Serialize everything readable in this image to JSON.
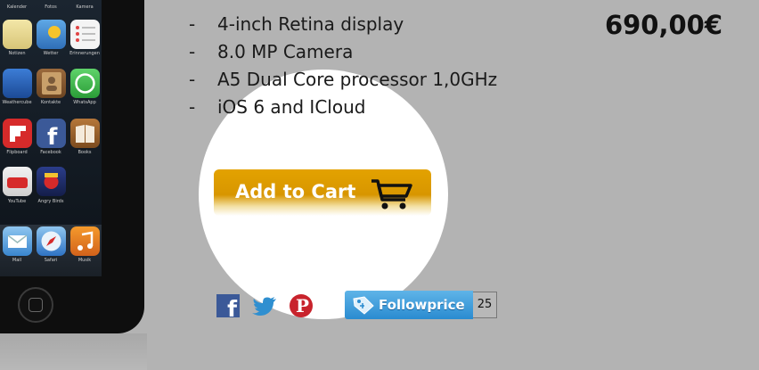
{
  "product": {
    "features": [
      {
        "dash": "-",
        "text": "4-inch Retina display"
      },
      {
        "dash": "-",
        "text": "8.0 MP Camera"
      },
      {
        "dash": "-",
        "text": "A5 Dual Core processor 1,0GHz"
      },
      {
        "dash": "-",
        "text": "iOS 6 and ICloud"
      }
    ],
    "price": "690,00€"
  },
  "cart_button": {
    "label": "Add to Cart",
    "icon": "cart-icon",
    "color": "#e3a200"
  },
  "social": {
    "facebook": {
      "icon": "facebook-icon",
      "glyph": "f"
    },
    "twitter": {
      "icon": "twitter-icon"
    },
    "pinterest": {
      "icon": "pinterest-icon",
      "glyph": "P"
    }
  },
  "followprice": {
    "label": "Followprice",
    "count": "25",
    "icon": "price-tag-icon"
  },
  "phone": {
    "apps": [
      {
        "label": "Kalender"
      },
      {
        "label": "Fotos"
      },
      {
        "label": "Kamera"
      },
      {
        "label": "Notizen"
      },
      {
        "label": "Wetter"
      },
      {
        "label": "Erinnerungen"
      },
      {
        "label": "Weathercube"
      },
      {
        "label": "Kontakte"
      },
      {
        "label": "WhatsApp"
      },
      {
        "label": "Flipboard"
      },
      {
        "label": "Facebook"
      },
      {
        "label": "Books"
      },
      {
        "label": "YouTube"
      },
      {
        "label": "Angry Birds"
      },
      {
        "label": "Mail"
      },
      {
        "label": "Safari"
      },
      {
        "label": "Musik"
      }
    ]
  }
}
